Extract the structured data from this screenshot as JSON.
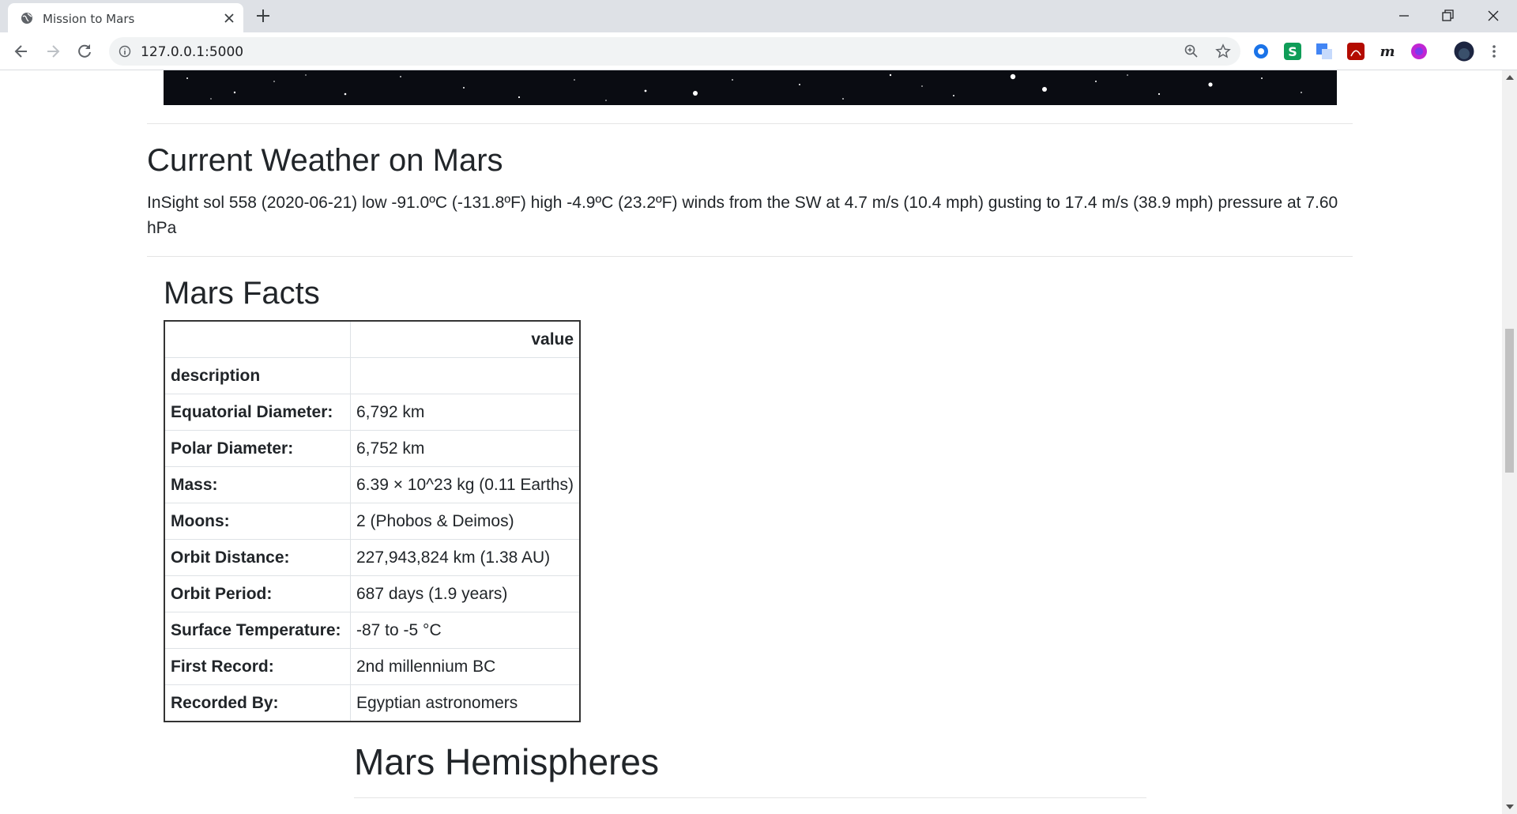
{
  "browser": {
    "tab_title": "Mission to Mars",
    "url": "127.0.0.1:5000"
  },
  "page": {
    "weather_heading": "Current Weather on Mars",
    "weather_text": "InSight sol 558 (2020-06-21) low -91.0ºC (-131.8ºF) high -4.9ºC (23.2ºF) winds from the SW at 4.7 m/s (10.4 mph) gusting to 17.4 m/s (38.9 mph) pressure at 7.60 hPa",
    "facts_heading": "Mars Facts",
    "facts_table": {
      "header_value": "value",
      "index_label": "description",
      "rows": [
        {
          "label": "Equatorial Diameter:",
          "value": "6,792 km"
        },
        {
          "label": "Polar Diameter:",
          "value": "6,752 km"
        },
        {
          "label": "Mass:",
          "value": "6.39 × 10^23 kg (0.11 Earths)"
        },
        {
          "label": "Moons:",
          "value": "2 (Phobos & Deimos)"
        },
        {
          "label": "Orbit Distance:",
          "value": "227,943,824 km (1.38 AU)"
        },
        {
          "label": "Orbit Period:",
          "value": "687 days (1.9 years)"
        },
        {
          "label": "Surface Temperature:",
          "value": "-87 to -5 °C"
        },
        {
          "label": "First Record:",
          "value": "2nd millennium BC"
        },
        {
          "label": "Recorded By:",
          "value": "Egyptian astronomers"
        }
      ]
    },
    "hemispheres_heading": "Mars Hemispheres"
  },
  "icons": {
    "favicon": "globe-icon",
    "extensions": [
      "crosshair-icon",
      "s-icon",
      "translate-icon",
      "pdf-icon",
      "m-icon",
      "purple-circle-icon",
      "profile-avatar"
    ]
  },
  "colors": {
    "tabbar": "#dee1e6",
    "text": "#212529"
  }
}
